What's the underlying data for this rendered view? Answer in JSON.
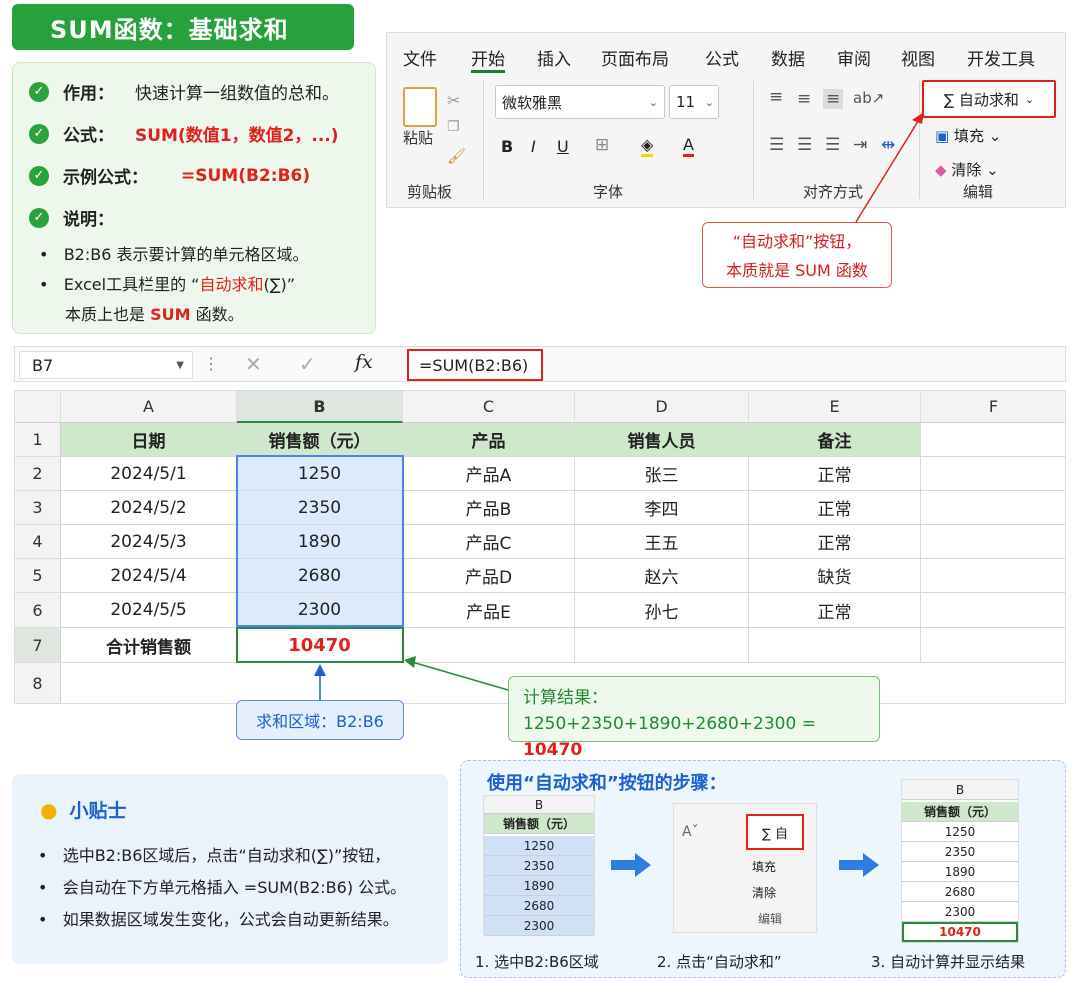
{
  "title": "SUM函数：基础求和",
  "info": {
    "purpose_label": "作用：",
    "purpose_value": "快速计算一组数值的总和。",
    "formula_label": "公式：",
    "formula_value": "SUM(数值1，数值2，...)",
    "example_label": "示例公式：",
    "example_value": "=SUM(B2:B6)",
    "note_label": "说明：",
    "note1": "B2:B6 表示要计算的单元格区域。",
    "note2_a": "Excel工具栏里的 “",
    "note2_red": "自动求和",
    "note2_b": "(∑)”",
    "note3_a": "本质上也是 ",
    "note3_red": "SUM",
    "note3_b": " 函数。"
  },
  "ribbon": {
    "tabs": [
      "文件",
      "开始",
      "插入",
      "页面布局",
      "公式",
      "数据",
      "审阅",
      "视图",
      "开发工具"
    ],
    "paste_label": "粘贴",
    "clipboard_group": "剪贴板",
    "font_name": "微软雅黑",
    "font_size": "11",
    "font_group": "字体",
    "align_group": "对齐方式",
    "autosum_label": "∑ 自动求和",
    "fill_label": "填充",
    "clear_label": "清除",
    "edit_group": "编辑"
  },
  "callout": {
    "line1": "“自动求和”按钮，",
    "line2": "本质就是 SUM 函数"
  },
  "formula_bar": {
    "cell_ref": "B7",
    "formula": "=SUM(B2:B6)"
  },
  "sheet": {
    "columns": [
      "A",
      "B",
      "C",
      "D",
      "E",
      "F"
    ],
    "rows": [
      "1",
      "2",
      "3",
      "4",
      "5",
      "6",
      "7",
      "8"
    ],
    "headers": [
      "日期",
      "销售额（元）",
      "产品",
      "销售人员",
      "备注"
    ],
    "data": [
      [
        "2024/5/1",
        "1250",
        "产品A",
        "张三",
        "正常"
      ],
      [
        "2024/5/2",
        "2350",
        "产品B",
        "李四",
        "正常"
      ],
      [
        "2024/5/3",
        "1890",
        "产品C",
        "王五",
        "正常"
      ],
      [
        "2024/5/4",
        "2680",
        "产品D",
        "赵六",
        "缺货"
      ],
      [
        "2024/5/5",
        "2300",
        "产品E",
        "孙七",
        "正常"
      ]
    ],
    "total_label": "合计销售额",
    "total_value": "10470"
  },
  "annotations": {
    "range_label": "求和区域：B2:B6",
    "result_title": "计算结果：",
    "result_expr": "1250+2350+1890+2680+2300 = ",
    "result_value": "10470"
  },
  "tips": {
    "title": "小贴士",
    "items": [
      "选中B2:B6区域后，点击“自动求和(∑)”按钮，",
      "会自动在下方单元格插入 =SUM(B2:B6) 公式。",
      "如果数据区域发生变化，公式会自动更新结果。"
    ]
  },
  "steps": {
    "title": "使用“自动求和”按钮的步骤：",
    "col_letter": "B",
    "col_header": "销售额（元）",
    "values": [
      "1250",
      "2350",
      "1890",
      "2680",
      "2300"
    ],
    "total": "10470",
    "mini_autosum": "∑ 自",
    "mini_fill": "填充",
    "mini_clear": "清除",
    "mini_edit": "编辑",
    "captions": [
      "1. 选中B2:B6区域",
      "2. 点击“自动求和”",
      "3. 自动计算并显示结果"
    ]
  },
  "colors": {
    "green": "#26a13b",
    "red": "#e0211b",
    "blue": "#1e5fd1",
    "header_green": "#cfe8cc",
    "selection_blue": "#ddeafc"
  }
}
